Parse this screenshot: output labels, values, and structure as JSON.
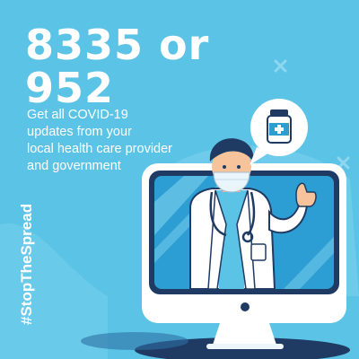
{
  "headline": {
    "line1": "8335 or",
    "line2": "952"
  },
  "subtext": {
    "lines": [
      "Get all COVID-19",
      "updates from your",
      "local health care provider",
      "and government"
    ]
  },
  "hashtag": "#StopTheSpread",
  "icons": {
    "speech_bubble": "medicine-bottle-icon",
    "decor": "x-mark-icon"
  },
  "colors": {
    "background": "#5bc4e6",
    "blob": "#7dd2ee",
    "screen": "#2d9ed3",
    "monitor_frame": "#ffffff",
    "monitor_bezel": "#1f3b63",
    "text": "#ffffff"
  }
}
